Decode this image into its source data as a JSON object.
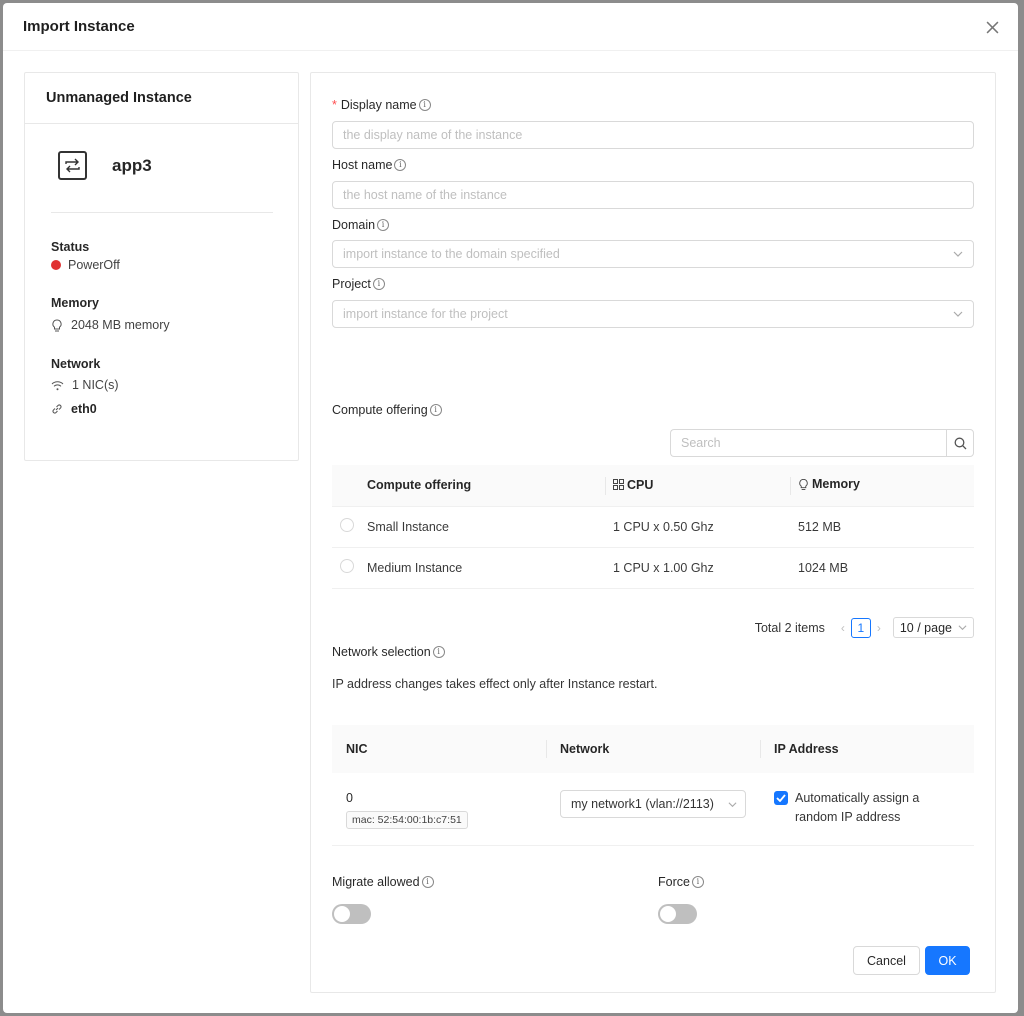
{
  "modal": {
    "title": "Import Instance"
  },
  "left": {
    "heading": "Unmanaged Instance",
    "instance_name": "app3",
    "status_label": "Status",
    "status_value": "PowerOff",
    "status_color": "#e03131",
    "memory_label": "Memory",
    "memory_value": "2048 MB memory",
    "network_label": "Network",
    "nic_count": "1 NIC(s)",
    "nic_name": "eth0"
  },
  "form": {
    "display_name": {
      "label": "Display name",
      "placeholder": "the display name of the instance"
    },
    "host_name": {
      "label": "Host name",
      "placeholder": "the host name of the instance"
    },
    "domain": {
      "label": "Domain",
      "placeholder": "import instance to the domain specified"
    },
    "project": {
      "label": "Project",
      "placeholder": "import instance for the project"
    },
    "compute_offering_label": "Compute offering",
    "search_placeholder": "Search"
  },
  "offering_table": {
    "headers": [
      "Compute offering",
      "CPU",
      "Memory"
    ],
    "rows": [
      {
        "name": "Small Instance",
        "cpu": "1 CPU x 0.50 Ghz",
        "memory": "512 MB"
      },
      {
        "name": "Medium Instance",
        "cpu": "1 CPU x 1.00 Ghz",
        "memory": "1024 MB"
      }
    ]
  },
  "pagination": {
    "total": "Total 2 items",
    "page": "1",
    "page_size": "10 / page"
  },
  "network": {
    "label": "Network selection",
    "note": "IP address changes takes effect only after Instance restart.",
    "headers": [
      "NIC",
      "Network",
      "IP Address"
    ],
    "row": {
      "nic": "0",
      "mac": "mac: 52:54:00:1b:c7:51",
      "network": "my network1 (vlan://2113)",
      "auto_ip_line1": "Automatically assign a",
      "auto_ip_line2": "random IP address"
    }
  },
  "toggles": {
    "migrate_label": "Migrate allowed",
    "force_label": "Force"
  },
  "buttons": {
    "cancel": "Cancel",
    "ok": "OK"
  },
  "colors": {
    "primary": "#1677ff",
    "required": "#ff4d4f"
  }
}
